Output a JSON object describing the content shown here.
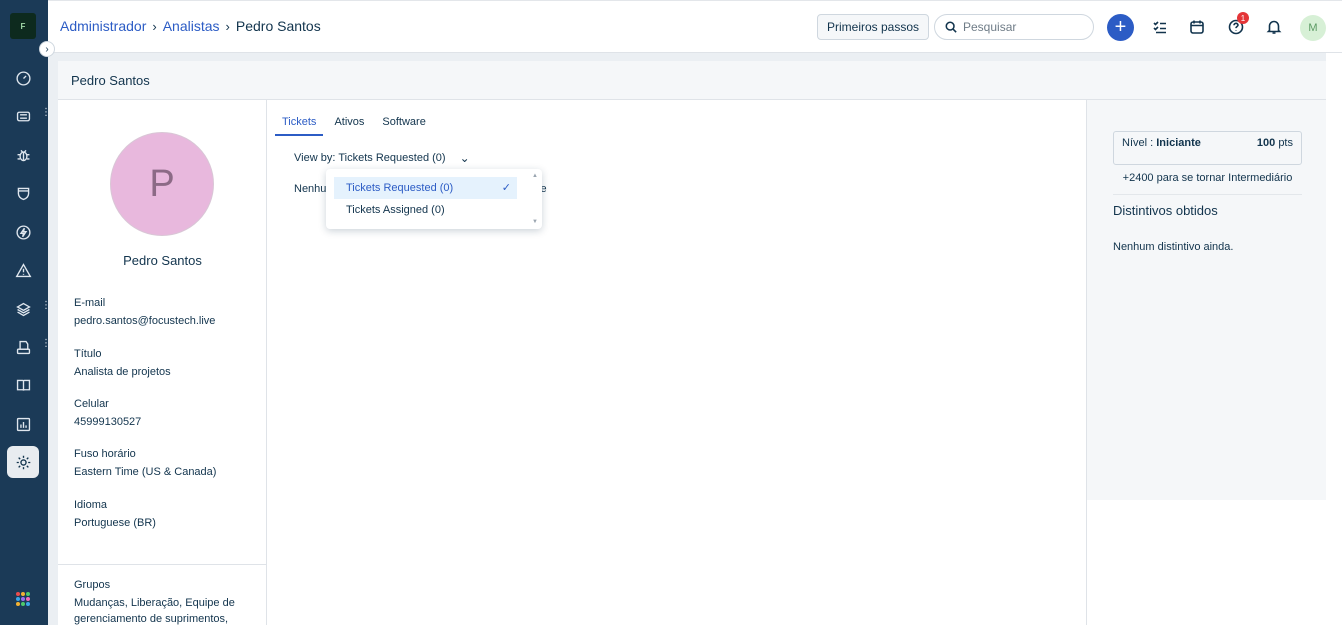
{
  "breadcrumb": {
    "items": [
      "Administrador",
      "Analistas"
    ],
    "current": "Pedro Santos"
  },
  "topbar": {
    "primeiros_passos": "Primeiros passos",
    "search_placeholder": "Pesquisar",
    "help_badge": "1",
    "avatar_initial": "M"
  },
  "page": {
    "title": "Pedro Santos"
  },
  "profile": {
    "initial": "P",
    "name": "Pedro Santos",
    "fields": [
      {
        "label": "E-mail",
        "value": "pedro.santos@focustech.live"
      },
      {
        "label": "Título",
        "value": "Analista de projetos"
      },
      {
        "label": "Celular",
        "value": "45999130527"
      },
      {
        "label": "Fuso horário",
        "value": "Eastern Time (US & Canada)"
      },
      {
        "label": "Idioma",
        "value": "Portuguese (BR)"
      }
    ],
    "groups_label": "Grupos",
    "groups_value": "Mudanças, Liberação, Equipe de gerenciamento de suprimentos,"
  },
  "tabs": [
    {
      "label": "Tickets",
      "active": true
    },
    {
      "label": "Ativos",
      "active": false
    },
    {
      "label": "Software",
      "active": false
    }
  ],
  "viewby": {
    "prefix": "View by:",
    "selected": "Tickets Requested (0)"
  },
  "empty_text": "Nenhu",
  "empty_text_tail": "te",
  "dropdown": {
    "options": [
      "Tickets Requested (0)",
      "Tickets Assigned (0)"
    ],
    "selected_index": 0
  },
  "gamification": {
    "level_label": "Nível :",
    "level_name": "Iniciante",
    "points": "100",
    "points_unit": "pts",
    "next_level": "+2400 para se tornar Intermediário",
    "badges_title": "Distintivos obtidos",
    "badges_empty": "Nenhum distintivo ainda."
  },
  "colors": {
    "nav_bg": "#1b3a57",
    "accent": "#2c5cc5",
    "avatar_bg": "#e8b8dd"
  }
}
